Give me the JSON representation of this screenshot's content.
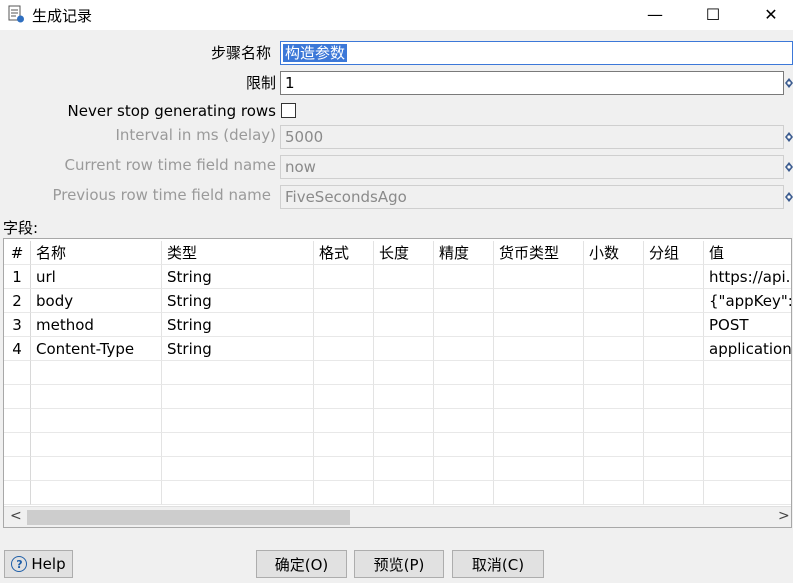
{
  "window": {
    "title": "生成记录",
    "minimize": "—",
    "maximize": "☐",
    "close": "✕"
  },
  "form": {
    "step_name_label": "步骤名称",
    "step_name_value": "构造参数",
    "limit_label": "限制",
    "limit_value": "1",
    "never_stop_label": "Never stop generating rows",
    "interval_label": "Interval in ms (delay)",
    "interval_value": "5000",
    "current_row_label": "Current row time field name",
    "current_row_value": "now",
    "previous_row_label": "Previous row time field name",
    "previous_row_value": "FiveSecondsAgo"
  },
  "fields": {
    "section_label": "字段:",
    "columns": [
      "#",
      "名称",
      "类型",
      "格式",
      "长度",
      "精度",
      "货币类型",
      "小数",
      "分组",
      "值"
    ],
    "rows": [
      [
        "1",
        "url",
        "String",
        "",
        "",
        "",
        "",
        "",
        "",
        "https://api.c"
      ],
      [
        "2",
        "body",
        "String",
        "",
        "",
        "",
        "",
        "",
        "",
        "{\"appKey\":\""
      ],
      [
        "3",
        "method",
        "String",
        "",
        "",
        "",
        "",
        "",
        "",
        "POST"
      ],
      [
        "4",
        "Content-Type",
        "String",
        "",
        "",
        "",
        "",
        "",
        "",
        "application/"
      ]
    ],
    "sort_icon": "^",
    "scroll_left": "<",
    "scroll_right": ">"
  },
  "buttons": {
    "help": "Help",
    "ok": "确定(O)",
    "preview": "预览(P)",
    "cancel": "取消(C)"
  }
}
